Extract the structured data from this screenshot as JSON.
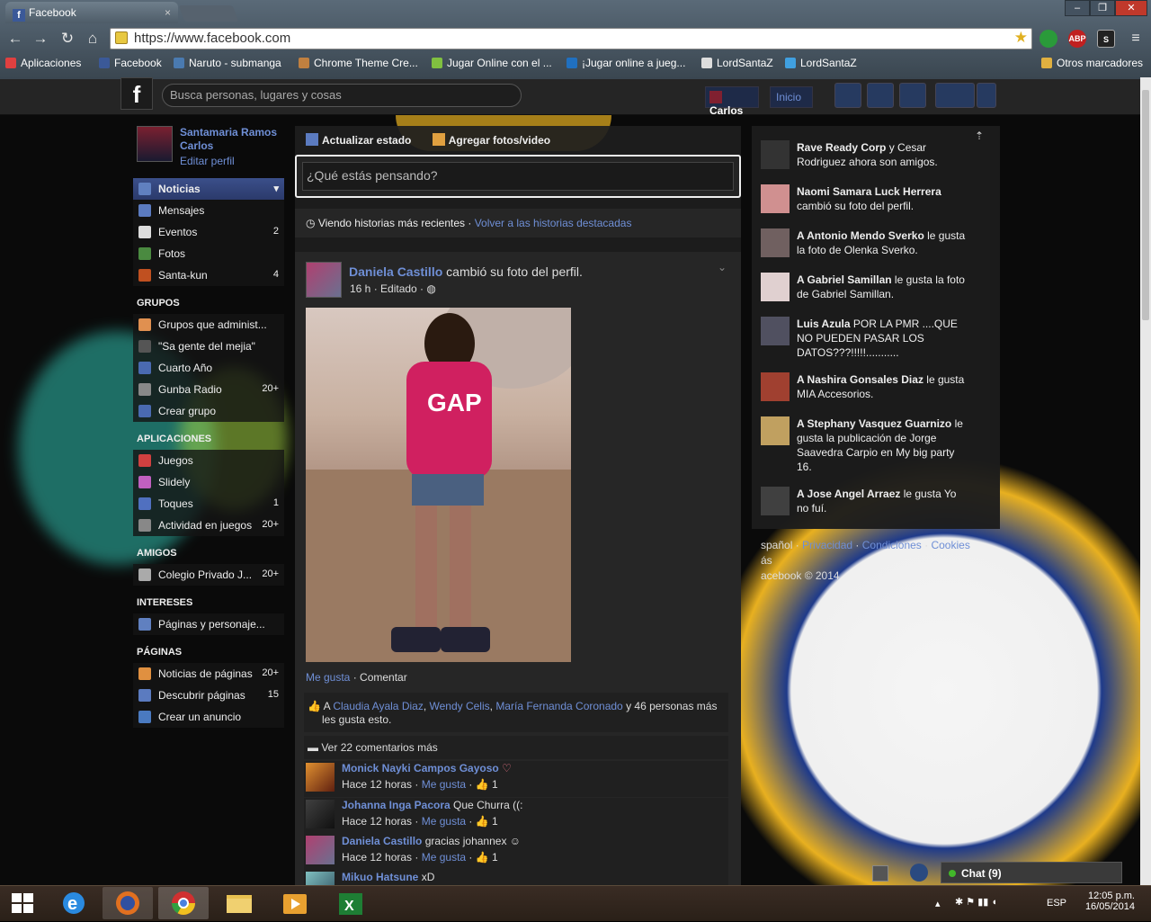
{
  "browser": {
    "tab_title": "Facebook",
    "tab_close": "×",
    "url": "https://www.facebook.com",
    "window_controls": [
      "–",
      "❐",
      "✕"
    ],
    "nav_icons": [
      "back-icon",
      "forward-icon",
      "reload-icon",
      "home-icon"
    ],
    "extensions": [
      "hangouts",
      "ABP",
      "S"
    ],
    "bookmarks": [
      {
        "label": "Aplicaciones",
        "icon": "apps-icon",
        "color": "#e04040"
      },
      {
        "label": "Facebook",
        "icon": "facebook-icon",
        "color": "#3b5998"
      },
      {
        "label": "Naruto - submanga",
        "icon": "submanga-icon",
        "color": "#4a7ab0"
      },
      {
        "label": "Chrome Theme Cre...",
        "icon": "theme-icon",
        "color": "#c08040"
      },
      {
        "label": "Jugar Online con el ...",
        "icon": "plus-icon",
        "color": "#80c040"
      },
      {
        "label": "¡Jugar online a jueg...",
        "icon": "t-icon",
        "color": "#2070c0"
      },
      {
        "label": "LordSantaZ",
        "icon": "bookmark-s-icon",
        "color": "#dddddd"
      },
      {
        "label": "LordSantaZ",
        "icon": "diamond-icon",
        "color": "#40a0e0"
      }
    ],
    "other_bookmarks": "Otros marcadores"
  },
  "fb_header": {
    "logo": "f",
    "search_placeholder": "Busca personas, lugares y cosas",
    "user_name": "Carlos",
    "home": "Inicio"
  },
  "left": {
    "profile_name": "Santamaria Ramos Carlos",
    "edit_profile": "Editar perfil",
    "favorites": [
      {
        "label": "Noticias",
        "count": "",
        "color": "#3b5998",
        "selected": true
      },
      {
        "label": "Mensajes",
        "count": "",
        "color": "#5b7bc0"
      },
      {
        "label": "Eventos",
        "count": "2",
        "color": "#dddddd"
      },
      {
        "label": "Fotos",
        "count": "",
        "color": "#4a8a40"
      },
      {
        "label": "Santa-kun",
        "count": "4",
        "color": "#c05020"
      }
    ],
    "groups_title": "GRUPOS",
    "groups": [
      {
        "label": "Grupos que administ...",
        "count": "",
        "color": "#e09050"
      },
      {
        "label": "\"Sa gente del mejia\"",
        "count": "",
        "color": "#555555"
      },
      {
        "label": "Cuarto Año",
        "count": "",
        "color": "#4a6ab0"
      },
      {
        "label": "Gunba Radio",
        "count": "20+",
        "color": "#888888"
      },
      {
        "label": "Crear grupo",
        "count": "",
        "color": "#4a6ab0"
      }
    ],
    "apps_title": "APLICACIONES",
    "apps": [
      {
        "label": "Juegos",
        "count": "",
        "color": "#d04040"
      },
      {
        "label": "Slidely",
        "count": "",
        "color": "#c060c0"
      },
      {
        "label": "Toques",
        "count": "1",
        "color": "#5070c0"
      },
      {
        "label": "Actividad en juegos",
        "count": "20+",
        "color": "#888888"
      }
    ],
    "friends_title": "AMIGOS",
    "friends": [
      {
        "label": "Colegio Privado J...",
        "count": "20+",
        "color": "#aaaaaa"
      }
    ],
    "interests_title": "INTERESES",
    "interests": [
      {
        "label": "Páginas y personaje...",
        "count": "",
        "color": "#6080c0"
      }
    ],
    "pages_title": "PÁGINAS",
    "pages": [
      {
        "label": "Noticias de páginas",
        "count": "20+",
        "color": "#e09040"
      },
      {
        "label": "Descubrir páginas",
        "count": "15",
        "color": "#5b7bc0"
      },
      {
        "label": "Crear un anuncio",
        "count": "",
        "color": "#4a7ac0"
      }
    ]
  },
  "composer": {
    "update_status": "Actualizar estado",
    "add_photos": "Agregar fotos/video",
    "placeholder": "¿Qué estás pensando?"
  },
  "feed": {
    "recent_text": "Viendo historias más recientes",
    "back_link": "Volver a las historias destacadas",
    "post": {
      "author": "Daniela Castillo",
      "action": "cambió su foto del perfil.",
      "meta": "16 h · Editado ·",
      "like": "Me gusta",
      "comment": "Comentar",
      "likes_prefix": "A",
      "likers": [
        "Claudia Ayala Diaz",
        "Wendy Celis",
        "María Fernanda Coronado"
      ],
      "likes_suffix": "y 46 personas más",
      "likes_line2": "les gusta esto.",
      "more_comments": "Ver 22 comentarios más",
      "comments": [
        {
          "author": "Monick Nayki Campos Gayoso",
          "text": "♡",
          "time": "Hace 12 horas",
          "like": "Me gusta",
          "likes": "1"
        },
        {
          "author": "Johanna Inga Pacora",
          "text": "Que Churra ((:",
          "time": "Hace 12 horas",
          "like": "Me gusta",
          "likes": "1"
        },
        {
          "author": "Daniela Castillo",
          "text": "gracias johannex ☺",
          "time": "Hace 12 horas",
          "like": "Me gusta",
          "likes": "1"
        },
        {
          "author": "Mikuo Hatsune",
          "text": "xD",
          "time": "",
          "like": "",
          "likes": ""
        }
      ]
    }
  },
  "ticker": [
    {
      "bold": "Rave Ready Corp",
      "text": " y Cesar Rodriguez ahora son amigos.",
      "color": "#333333"
    },
    {
      "bold": "Naomi Samara Luck Herrera",
      "text": " cambió su foto del perfil.",
      "color": "#d09090"
    },
    {
      "bold": "A Antonio Mendo Sverko",
      "text": " le gusta la foto de Olenka Sverko.",
      "color": "#706060"
    },
    {
      "bold": "A Gabriel Samillan",
      "text": " le gusta la foto de Gabriel Samillan.",
      "color": "#e0d0d0"
    },
    {
      "bold": "Luis Azula",
      "text": " POR LA PMR ....QUE NO PUEDEN PASAR LOS DATOS???!!!!!...........",
      "color": "#505060"
    },
    {
      "bold": "A Nashira Gonsales Diaz",
      "text": " le gusta MIA Accesorios.",
      "color": "#a04030"
    },
    {
      "bold": "A Stephany Vasquez Guarnizo",
      "text": " le gusta la publicación de Jorge Saavedra Carpio en My big party 16.",
      "color": "#c0a060"
    },
    {
      "bold": "A Jose Angel Arraez",
      "text": " le gusta Yo no fuí.",
      "color": "#404040"
    }
  ],
  "footer": {
    "language": "spañol",
    "links": [
      "Privacidad",
      "Condiciones",
      "Cookies"
    ],
    "more": "ás",
    "copyright": "acebook © 2014"
  },
  "chat": {
    "label": "Chat (9)"
  },
  "taskbar": {
    "lang": "ESP",
    "time": "12:05 p.m.",
    "date": "16/05/2014"
  }
}
